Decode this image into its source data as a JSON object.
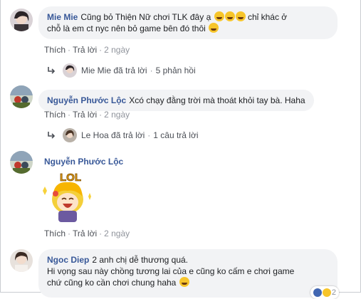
{
  "comments": [
    {
      "name": "Mie Mie",
      "text_line1": "Cũng bỏ Thiện Nữ chơi TLK đây ạ",
      "text_line1b": "chỉ khác ở",
      "text_line2": "chỗ là em ct nyc nên bỏ game bên đó thôi",
      "actions": {
        "like": "Thích",
        "reply": "Trả lời",
        "time": "2 ngày"
      },
      "replies": {
        "who": "Mie Mie",
        "verb": "đã trả lời",
        "count": "5 phản hồi"
      }
    },
    {
      "name": "Nguyễn Phước Lộc",
      "text": "Xcó chạy đằng trời mà thoát khỏi tay bà. Haha",
      "actions": {
        "like": "Thích",
        "reply": "Trả lời",
        "time": "2 ngày"
      },
      "replies": {
        "who": "Le Hoa",
        "verb": "đã trả lời",
        "count": "1 câu trả lời"
      }
    },
    {
      "name": "Nguyễn Phước Lộc",
      "sticker_text": "LOL",
      "actions": {
        "like": "Thích",
        "reply": "Trả lời",
        "time": "2 ngày"
      }
    },
    {
      "name": "Ngoc Diep",
      "text_line1": "2 anh chị dễ thương quá.",
      "text_line2": "Hi vọng sau này chồng tương lai của e cũng ko cấm e chơi game",
      "text_line3": "chứ cũng ko cần chơi chung haha",
      "reaction_count": "2"
    }
  ],
  "separator": "·",
  "colors": {
    "name": "#385898",
    "bubble": "#f2f3f5",
    "meta": "#90949c"
  }
}
